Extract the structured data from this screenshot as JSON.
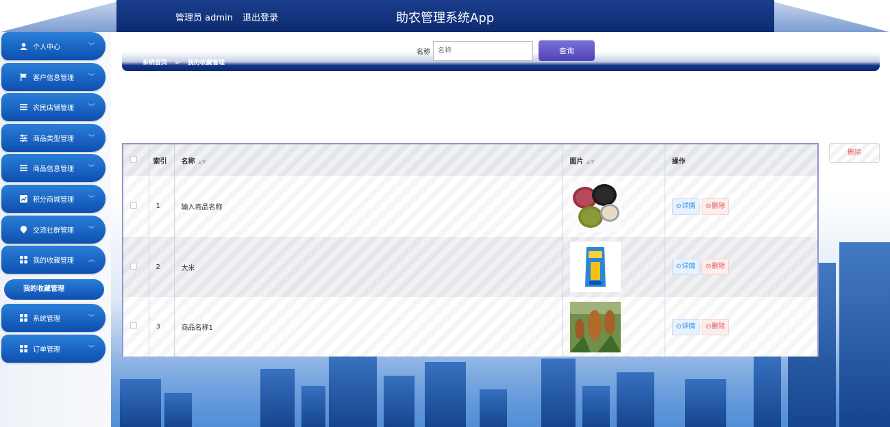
{
  "header": {
    "user_label": "管理员 admin",
    "logout_label": "退出登录",
    "app_title": "助农管理系统App"
  },
  "sidebar": {
    "items": [
      {
        "label": "个人中心",
        "icon": "user-icon"
      },
      {
        "label": "客户信息管理",
        "icon": "flag-icon"
      },
      {
        "label": "农民店铺管理",
        "icon": "list-icon"
      },
      {
        "label": "商品类型管理",
        "icon": "sliders-icon"
      },
      {
        "label": "商品信息管理",
        "icon": "list-icon"
      },
      {
        "label": "积分商城管理",
        "icon": "chart-icon"
      },
      {
        "label": "交流社群管理",
        "icon": "pin-icon"
      },
      {
        "label": "我的收藏管理",
        "icon": "grid-icon"
      },
      {
        "label": "系统管理",
        "icon": "grid-icon"
      },
      {
        "label": "订单管理",
        "icon": "grid-icon"
      }
    ],
    "active_sub": "我的收藏管理"
  },
  "breadcrumb": {
    "home": "系统首页",
    "sep": ">",
    "current": "我的收藏管理"
  },
  "search": {
    "label": "名称",
    "placeholder": "名称",
    "button": "查询"
  },
  "batch_delete": "删除",
  "table": {
    "headers": {
      "index": "索引",
      "name": "名称",
      "image": "图片",
      "actions": "操作"
    },
    "detail_label": "⊙详情",
    "delete_label": "⊖删除",
    "rows": [
      {
        "index": "1",
        "name": "输入商品名称",
        "image": "beans-bowls-image"
      },
      {
        "index": "2",
        "name": "大米",
        "image": "rice-bag-image"
      },
      {
        "index": "3",
        "name": "商品名称1",
        "image": "millet-field-image"
      }
    ]
  }
}
